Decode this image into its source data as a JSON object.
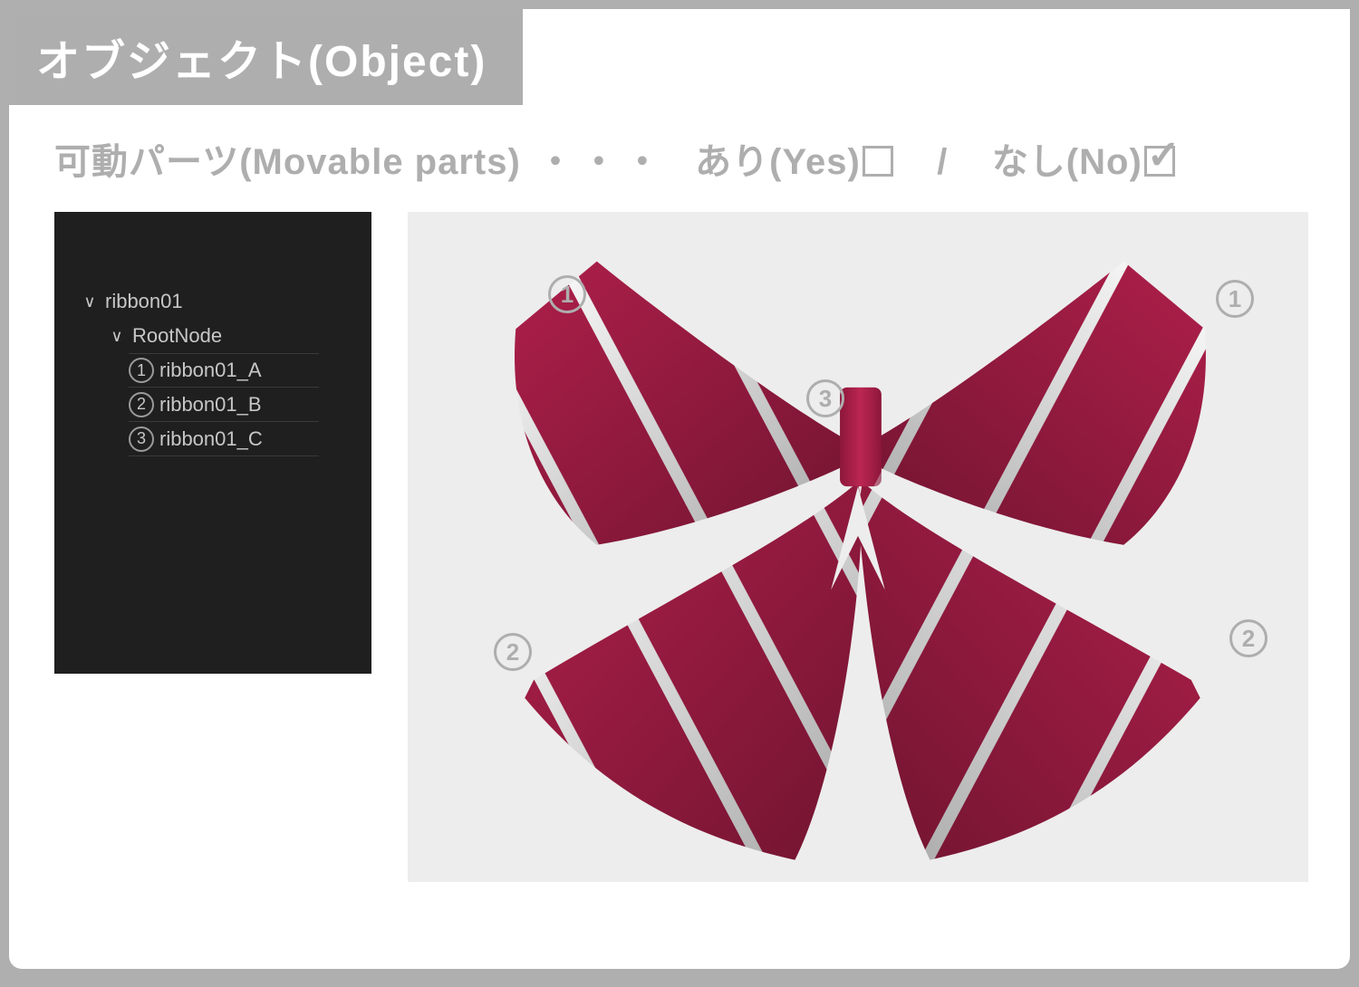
{
  "title": "オブジェクト(Object)",
  "movable": {
    "label": "可動パーツ(Movable parts)",
    "dots": "・・・",
    "yes_label": "あり(Yes)",
    "sep": "/",
    "no_label": "なし(No)",
    "yes_checked": false,
    "no_checked": true
  },
  "hierarchy": {
    "root": "ribbon01",
    "node": "RootNode",
    "children": [
      {
        "num": "1",
        "name": "ribbon01_A"
      },
      {
        "num": "2",
        "name": "ribbon01_B"
      },
      {
        "num": "3",
        "name": "ribbon01_C"
      }
    ]
  },
  "markers": {
    "top_left": "1",
    "top_right": "1",
    "center": "3",
    "bottom_left": "2",
    "bottom_right": "2"
  },
  "colors": {
    "ribbon": "#AE1F4A",
    "ribbon_dark": "#8A1238",
    "stripe": "#FFFFFF",
    "panel": "#EDEDED",
    "frame": "#AFAFAF"
  }
}
